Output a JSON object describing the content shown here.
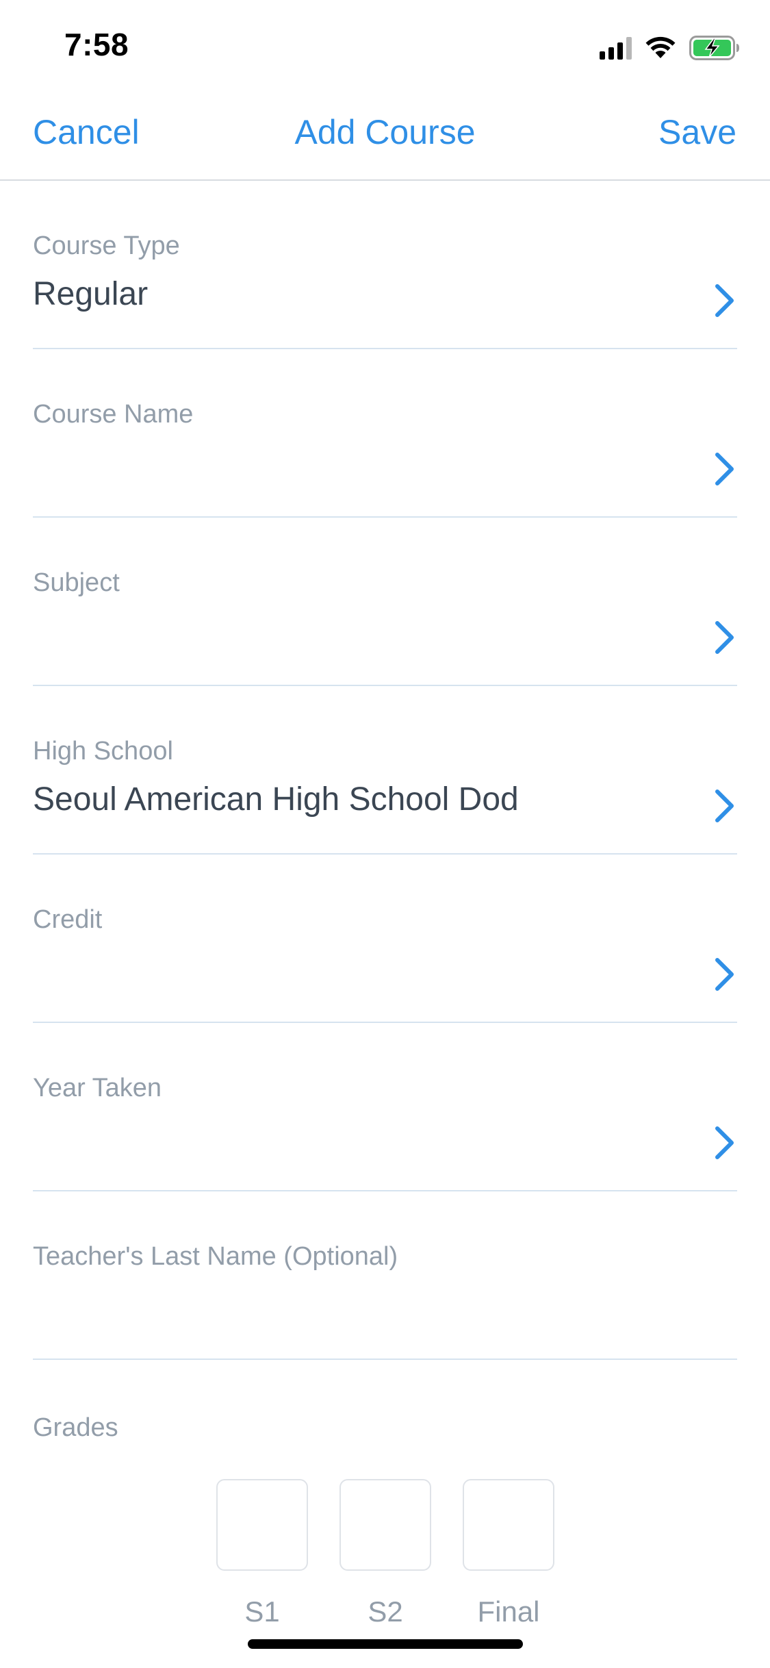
{
  "status_bar": {
    "time": "7:58"
  },
  "nav": {
    "cancel_label": "Cancel",
    "title": "Add Course",
    "save_label": "Save"
  },
  "form": {
    "course_type": {
      "label": "Course Type",
      "value": "Regular"
    },
    "course_name": {
      "label": "Course Name",
      "value": ""
    },
    "subject": {
      "label": "Subject",
      "value": ""
    },
    "high_school": {
      "label": "High School",
      "value": "Seoul American High School Dod"
    },
    "credit": {
      "label": "Credit",
      "value": ""
    },
    "year_taken": {
      "label": "Year Taken",
      "value": ""
    },
    "teacher_last_name": {
      "label": "Teacher's Last Name (Optional)",
      "value": ""
    }
  },
  "grades": {
    "label": "Grades",
    "boxes": [
      {
        "caption": "S1",
        "value": ""
      },
      {
        "caption": "S2",
        "value": ""
      },
      {
        "caption": "Final",
        "value": ""
      }
    ]
  },
  "colors": {
    "accent": "#2f8fe6",
    "label_gray": "#929da9",
    "value_text": "#3b4653",
    "divider": "#d6e3ef",
    "battery_charging": "#34c759"
  },
  "icons": {
    "row_disclosure": "chevron-right-icon",
    "status": [
      "cellular-signal-icon",
      "wifi-icon",
      "battery-charging-icon"
    ]
  }
}
